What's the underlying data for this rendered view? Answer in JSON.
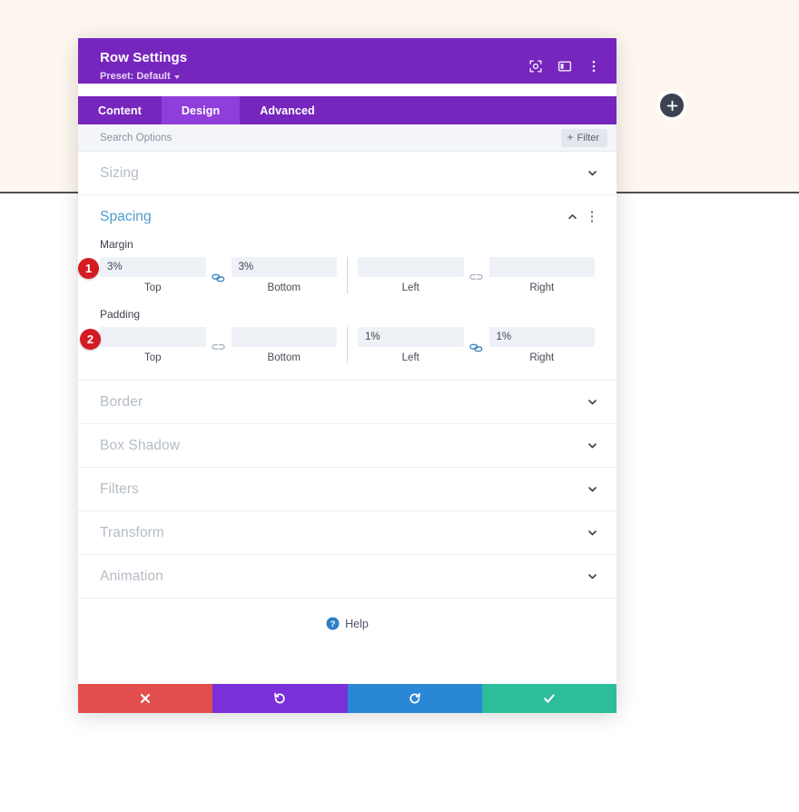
{
  "canvas": {
    "background_top": "#fdf7ef",
    "background_bottom": "#ffffff",
    "divider_color": "#4f4f4f",
    "add_button_label": "+"
  },
  "modal": {
    "title": "Row Settings",
    "preset": "Preset: Default",
    "header_color": "#7626bd",
    "header_icons": [
      {
        "name": "focus-target-icon",
        "label": "Focus"
      },
      {
        "name": "layout-columns-icon",
        "label": "Layout"
      },
      {
        "name": "more-options-icon",
        "label": "More"
      }
    ],
    "tabs": [
      {
        "label": "Content",
        "active": false
      },
      {
        "label": "Design",
        "active": true
      },
      {
        "label": "Advanced",
        "active": false
      }
    ],
    "search": {
      "value": "",
      "placeholder": "Search Options"
    },
    "filter_button": {
      "label": "Filter",
      "icon": "plus-icon"
    }
  },
  "sections": [
    {
      "title": "Sizing",
      "open": false
    },
    {
      "title": "Spacing",
      "open": true
    },
    {
      "title": "Border",
      "open": false
    },
    {
      "title": "Box Shadow",
      "open": false
    },
    {
      "title": "Filters",
      "open": false
    },
    {
      "title": "Transform",
      "open": false
    },
    {
      "title": "Animation",
      "open": false
    }
  ],
  "spacing": {
    "accent_color": "#4f9bd0",
    "margin": {
      "label": "Margin",
      "badge": "1",
      "fields": [
        {
          "caption": "Top",
          "value": "3%",
          "placeholder": ""
        },
        {
          "caption": "Bottom",
          "value": "3%",
          "placeholder": ""
        },
        {
          "caption": "Left",
          "value": "",
          "placeholder": ""
        },
        {
          "caption": "Right",
          "value": "",
          "placeholder": ""
        }
      ],
      "link_left_right": "linked",
      "link_left_right_icon": "link-connected-icon",
      "link_right_pair": "unlinked",
      "link_right_pair_icon": "link-broken-icon"
    },
    "padding": {
      "label": "Padding",
      "badge": "2",
      "fields": [
        {
          "caption": "Top",
          "value": "",
          "placeholder": ""
        },
        {
          "caption": "Bottom",
          "value": "",
          "placeholder": ""
        },
        {
          "caption": "Left",
          "value": "1%",
          "placeholder": ""
        },
        {
          "caption": "Right",
          "value": "1%",
          "placeholder": ""
        }
      ],
      "link_left_pair": "unlinked",
      "link_left_pair_icon": "link-broken-icon",
      "link_right_pair": "linked",
      "link_right_pair_icon": "link-connected-icon"
    }
  },
  "help": {
    "label": "Help",
    "icon": "question-circle-icon"
  },
  "footer": {
    "buttons": [
      {
        "name": "cancel",
        "glyph": "✖",
        "color": "#e24e4e"
      },
      {
        "name": "undo",
        "glyph": "↺",
        "color": "#7a30d8"
      },
      {
        "name": "redo",
        "glyph": "↻",
        "color": "#2a87d6"
      },
      {
        "name": "save",
        "glyph": "✔",
        "color": "#2ebd9a"
      }
    ]
  }
}
